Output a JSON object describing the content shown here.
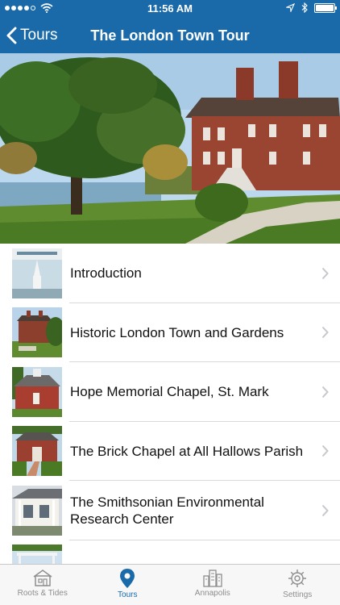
{
  "status_bar": {
    "time": "11:56 AM"
  },
  "nav": {
    "back_label": "Tours",
    "title": "The London Town Tour"
  },
  "tours": [
    {
      "label": "Introduction",
      "thumb": "book-cover-thumbnail"
    },
    {
      "label": "Historic London Town and Gardens",
      "thumb": "brick-house-thumbnail"
    },
    {
      "label": "Hope Memorial Chapel, St. Mark",
      "thumb": "red-chapel-thumbnail"
    },
    {
      "label": "The Brick Chapel at All Hallows Parish",
      "thumb": "brick-chapel-thumbnail"
    },
    {
      "label": "The Smithsonian Environmental Research Center",
      "thumb": "research-center-thumbnail"
    }
  ],
  "tabs": [
    {
      "label": "Roots & Tides",
      "icon": "house-icon",
      "active": false
    },
    {
      "label": "Tours",
      "icon": "map-pin-icon",
      "active": true
    },
    {
      "label": "Annapolis",
      "icon": "city-icon",
      "active": false
    },
    {
      "label": "Settings",
      "icon": "gear-icon",
      "active": false
    }
  ],
  "colors": {
    "brand": "#1a6aaa",
    "tab_inactive": "#8e8e8e",
    "separator": "#d9d9d9"
  }
}
